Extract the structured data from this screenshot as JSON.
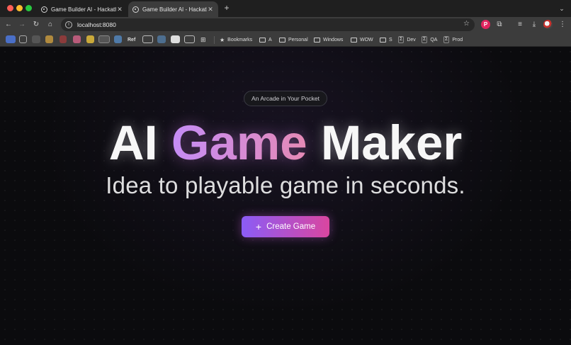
{
  "browser": {
    "tabs": [
      {
        "title": "Game Builder AI - Hackathon",
        "active": false
      },
      {
        "title": "Game Builder AI - Hackathon",
        "active": true
      }
    ],
    "new_tab_label": "+",
    "url": "localhost:8080",
    "toolbar_icons": [
      "back-icon",
      "forward-icon",
      "reload-icon",
      "home-icon",
      "info-icon",
      "star-icon",
      "pinterest-icon",
      "extensions-icon",
      "reading-list-icon",
      "download-icon",
      "avatar-icon",
      "menu-icon"
    ]
  },
  "bookmarks": {
    "ref_label": "Ref",
    "items": [
      {
        "label": "Bookmarks",
        "icon": "star-icon"
      },
      {
        "label": "A",
        "icon": "folder-icon"
      },
      {
        "label": "Personal",
        "icon": "folder-icon"
      },
      {
        "label": "Windows",
        "icon": "folder-icon"
      },
      {
        "label": "WOW",
        "icon": "folder-icon"
      },
      {
        "label": "S",
        "icon": "folder-icon"
      },
      {
        "label": "Dev",
        "icon": "sigma-icon"
      },
      {
        "label": "QA",
        "icon": "sigma-icon"
      },
      {
        "label": "Prod",
        "icon": "sigma-icon"
      }
    ]
  },
  "hero": {
    "badge": "An Arcade in Your Pocket",
    "title_part1": "AI ",
    "title_highlight": "Game",
    "title_part2": " Maker",
    "subtitle": "Idea to playable game in seconds.",
    "cta_label": "Create Game",
    "cta_icon": "plus-icon"
  },
  "colors": {
    "gradient_start": "#8b5cf6",
    "gradient_end": "#d946a0",
    "background": "#0b0b0e"
  }
}
